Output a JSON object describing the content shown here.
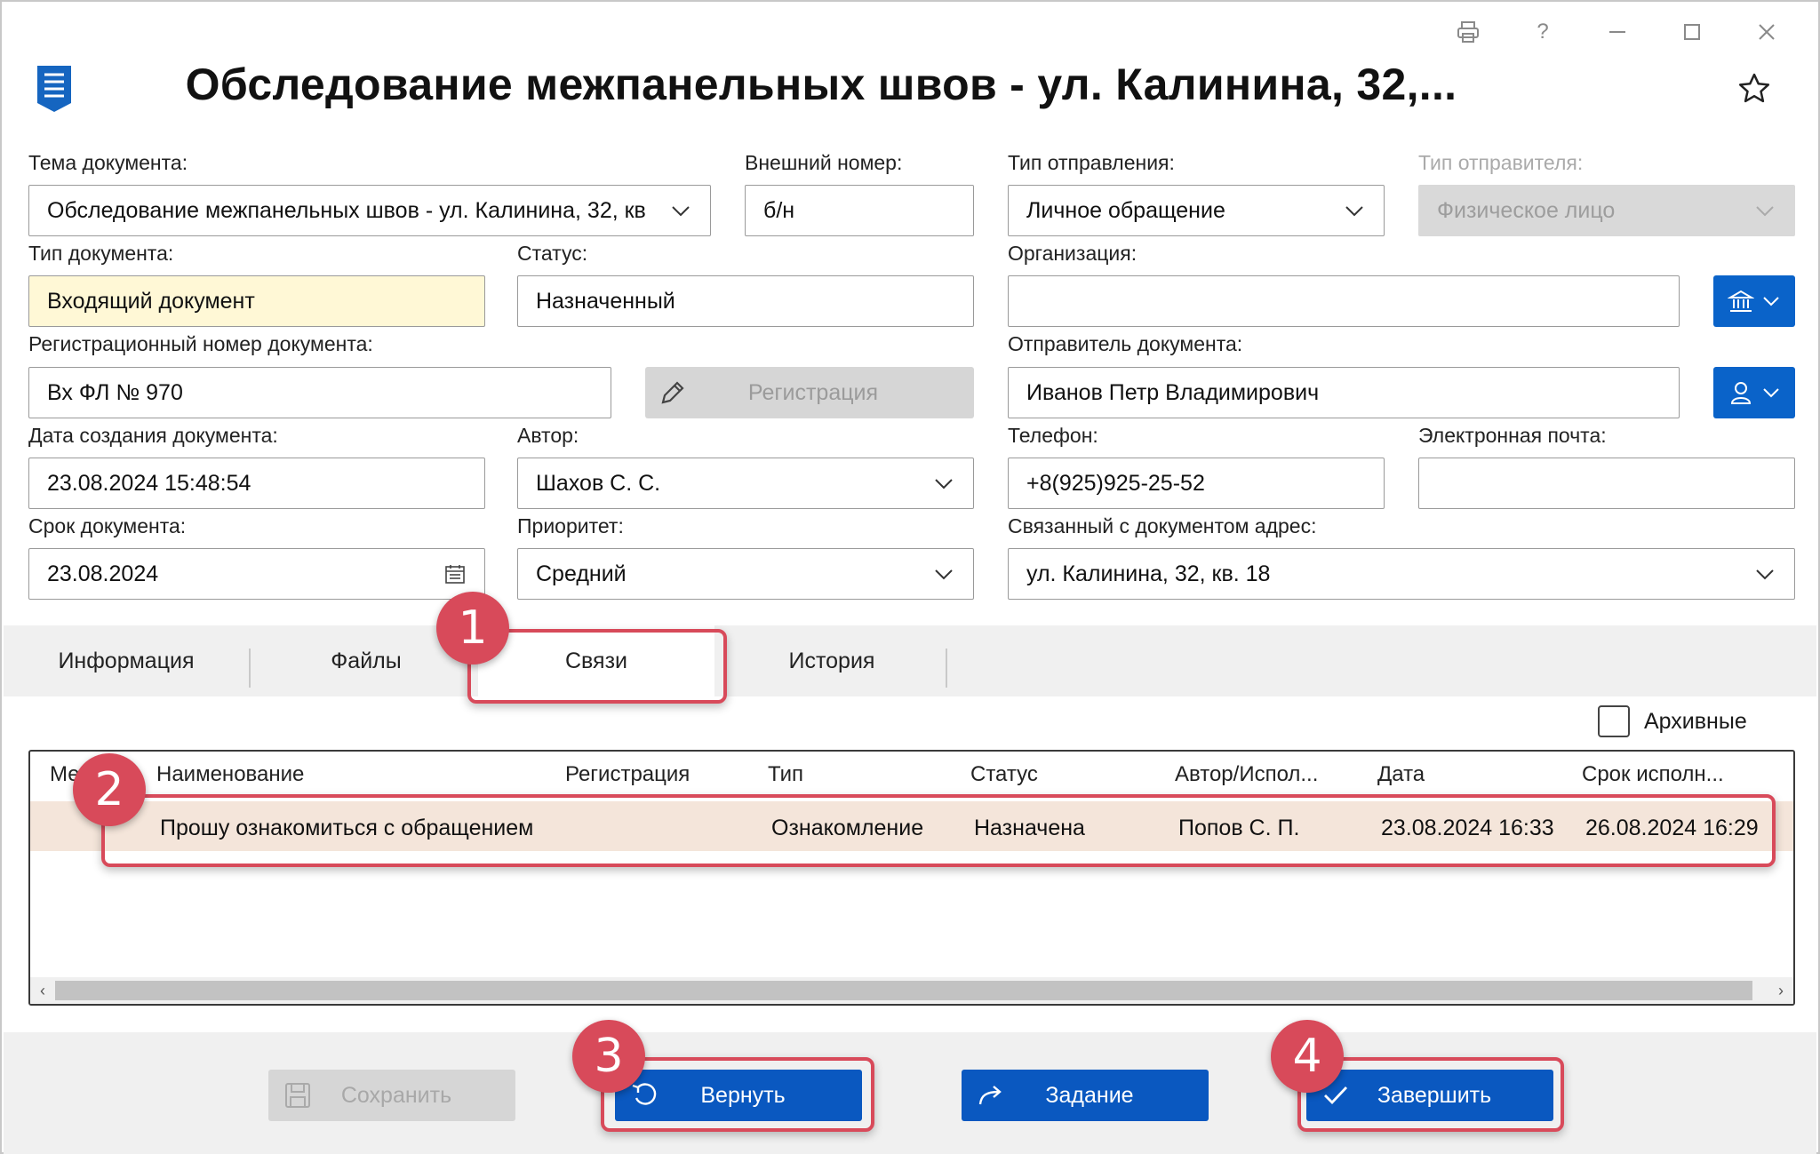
{
  "window": {
    "title": "Обследование межпанельных швов - ул. Калинина, 32,...",
    "controls": [
      "print-icon",
      "help-icon",
      "minimize-icon",
      "maximize-icon",
      "close-icon"
    ],
    "help_glyph": "?"
  },
  "form": {
    "subject": {
      "label": "Тема документа:",
      "value": "Обследование межпанельных швов - ул. Калинина, 32, кв"
    },
    "external_number": {
      "label": "Внешний номер:",
      "value": "б/н"
    },
    "dispatch_type": {
      "label": "Тип отправления:",
      "value": "Личное обращение"
    },
    "sender_type": {
      "label": "Тип отправителя:",
      "value": "Физическое лицо"
    },
    "doc_type": {
      "label": "Тип документа:",
      "value": "Входящий документ"
    },
    "status": {
      "label": "Статус:",
      "value": "Назначенный"
    },
    "organization": {
      "label": "Организация:",
      "value": ""
    },
    "reg_number": {
      "label": "Регистрационный номер документа:",
      "value": "Вх ФЛ № 970"
    },
    "register_button": "Регистрация",
    "sender": {
      "label": "Отправитель документа:",
      "value": "Иванов Петр Владимирович"
    },
    "created": {
      "label": "Дата создания документа:",
      "value": "23.08.2024 15:48:54"
    },
    "author": {
      "label": "Автор:",
      "value": "Шахов С. С."
    },
    "phone": {
      "label": "Телефон:",
      "value": "+8(925)925-25-52"
    },
    "email": {
      "label": "Электронная почта:",
      "value": ""
    },
    "deadline": {
      "label": "Срок документа:",
      "value": "23.08.2024"
    },
    "priority": {
      "label": "Приоритет:",
      "value": "Средний"
    },
    "address": {
      "label": "Связанный с документом адрес:",
      "value": "ул. Калинина, 32, кв. 18"
    }
  },
  "tabs": [
    {
      "label": "Информация"
    },
    {
      "label": "Файлы"
    },
    {
      "label": "Связи",
      "active": true
    },
    {
      "label": "История"
    }
  ],
  "archive_checkbox": {
    "label": "Архивные",
    "checked": false
  },
  "table": {
    "headers": [
      "Ме",
      "Наименование",
      "Регистрация",
      "Тип",
      "Статус",
      "Автор/Испол...",
      "Дата",
      "Срок исполн..."
    ],
    "rows": [
      {
        "name": "Прошу ознакомиться с обращением",
        "registration": "",
        "type": "Ознакомление",
        "status": "Назначена",
        "author": "Попов С. П.",
        "date": "23.08.2024 16:33",
        "due": "26.08.2024 16:29"
      }
    ],
    "scroll_left": "‹",
    "scroll_right": "›"
  },
  "footer": {
    "save": "Сохранить",
    "return": "Вернуть",
    "task": "Задание",
    "finish": "Завершить"
  },
  "annotations": [
    "1",
    "2",
    "3",
    "4"
  ],
  "colors": {
    "accent": "#0a58c0",
    "highlight": "#d84a5a",
    "selected_row": "#f4e5da",
    "required_field": "#fff8d6"
  }
}
